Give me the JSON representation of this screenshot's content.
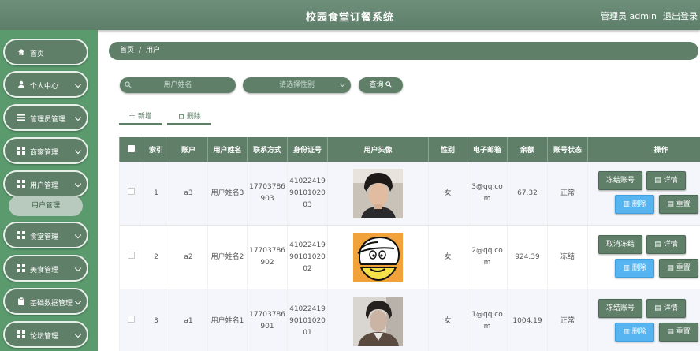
{
  "header": {
    "title": "校园食堂订餐系统",
    "admin": "管理员 admin",
    "logout": "退出登录"
  },
  "sidebar": {
    "items": [
      {
        "label": "首页",
        "icon": "home-icon"
      },
      {
        "label": "个人中心",
        "icon": "user-icon"
      },
      {
        "label": "管理员管理",
        "icon": "list-icon"
      },
      {
        "label": "商家管理",
        "icon": "grid-icon"
      },
      {
        "label": "用户管理",
        "icon": "grid-icon"
      },
      {
        "label": "食堂管理",
        "icon": "grid-icon"
      },
      {
        "label": "美食管理",
        "icon": "grid-icon"
      },
      {
        "label": "基础数据管理",
        "icon": "clipboard-icon"
      },
      {
        "label": "论坛管理",
        "icon": "grid-icon"
      }
    ],
    "submenu": "用户管理"
  },
  "breadcrumb": {
    "home": "首页",
    "sep": "/",
    "current": "用户"
  },
  "search": {
    "name_placeholder": "用户姓名",
    "gender_placeholder": "请选择性别",
    "query": "查询"
  },
  "actions": {
    "add": "新增",
    "delete": "删除"
  },
  "table": {
    "headers": [
      "",
      "索引",
      "账户",
      "用户姓名",
      "联系方式",
      "身份证号",
      "用户头像",
      "性别",
      "电子邮箱",
      "余额",
      "账号状态",
      "操作"
    ],
    "rows": [
      {
        "index": "1",
        "account": "a3",
        "name": "用户姓名3",
        "phone": "17703786903",
        "id": "410224199010102003",
        "avatar": "photo",
        "gender": "女",
        "email": "3@qq.com",
        "balance": "67.32",
        "status": "正常",
        "freeze": "冻结账号"
      },
      {
        "index": "2",
        "account": "a2",
        "name": "用户姓名2",
        "phone": "17703786902",
        "id": "410224199010102002",
        "avatar": "cartoon",
        "gender": "女",
        "email": "2@qq.com",
        "balance": "924.39",
        "status": "冻结",
        "freeze": "取消冻结"
      },
      {
        "index": "3",
        "account": "a1",
        "name": "用户姓名1",
        "phone": "17703786901",
        "id": "410224199010102001",
        "avatar": "photo-bw",
        "gender": "女",
        "email": "1@qq.com",
        "balance": "1004.19",
        "status": "正常",
        "freeze": "冻结账号"
      }
    ],
    "btn_detail": "详情",
    "btn_delete": "删除",
    "btn_reset": "重置"
  },
  "colors": {
    "primary": "#5f7f69",
    "sidebar": "#5a9a6d",
    "blue": "#56b4f0"
  }
}
